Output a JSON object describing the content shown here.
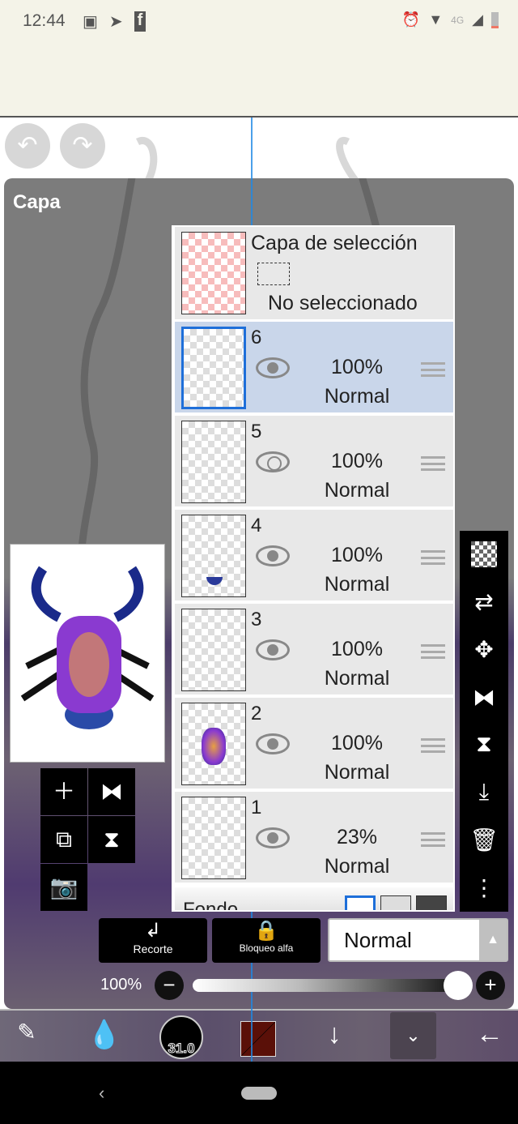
{
  "status_bar": {
    "time": "12:44",
    "network": "4G",
    "icons": [
      "gallery-icon",
      "telegram-icon",
      "facebook-icon",
      "alarm-icon",
      "wifi-icon",
      "signal-icon",
      "battery-icon"
    ]
  },
  "panel": {
    "title": "Capa"
  },
  "selection_layer": {
    "title": "Capa de selección",
    "status": "No seleccionado"
  },
  "layers": [
    {
      "number": "6",
      "opacity": "100%",
      "blend": "Normal",
      "selected": true,
      "visible": true
    },
    {
      "number": "5",
      "opacity": "100%",
      "blend": "Normal",
      "selected": false,
      "visible": true
    },
    {
      "number": "4",
      "opacity": "100%",
      "blend": "Normal",
      "selected": false,
      "visible": true
    },
    {
      "number": "3",
      "opacity": "100%",
      "blend": "Normal",
      "selected": false,
      "visible": true
    },
    {
      "number": "2",
      "opacity": "100%",
      "blend": "Normal",
      "selected": false,
      "visible": true
    },
    {
      "number": "1",
      "opacity": "23%",
      "blend": "Normal",
      "selected": false,
      "visible": true
    }
  ],
  "background_layer": {
    "label": "Fondo"
  },
  "buttons": {
    "clipping": "Recorte",
    "alpha_lock": "Bloqueo alfa"
  },
  "blend_mode": {
    "selected": "Normal"
  },
  "opacity": {
    "label": "100%",
    "value": 100
  },
  "brush_size": "31.0",
  "colors": {
    "accent": "#1e6fd9",
    "brush_color": "#5a1008",
    "selected_row": "#c9d6ea"
  }
}
